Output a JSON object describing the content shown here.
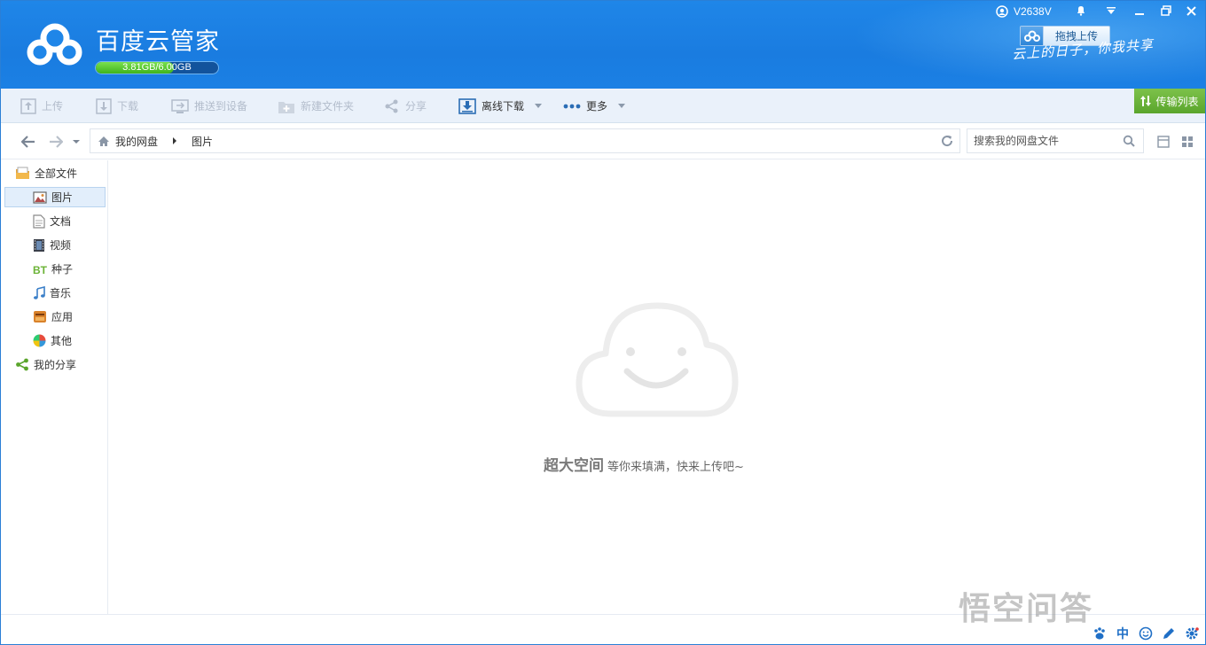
{
  "app": {
    "title": "百度云管家",
    "quota_text": "3.81GB/6.00GB",
    "quota_used_fraction": 0.635,
    "username": "V2638V",
    "drag_upload_label": "拖拽上传",
    "slogan": "云上的日子，你我共享"
  },
  "toolbar": {
    "upload": "上传",
    "download": "下载",
    "push": "推送到设备",
    "new_folder": "新建文件夹",
    "share": "分享",
    "offline": "离线下载",
    "more": "更多",
    "transfer_list": "传输列表"
  },
  "breadcrumb": {
    "root": "我的网盘",
    "current": "图片"
  },
  "search": {
    "placeholder": "搜索我的网盘文件"
  },
  "sidebar": {
    "items": [
      {
        "label": "全部文件",
        "icon": "folder-all-icon"
      },
      {
        "label": "图片",
        "icon": "picture-icon"
      },
      {
        "label": "文档",
        "icon": "document-icon"
      },
      {
        "label": "视频",
        "icon": "video-icon"
      },
      {
        "label": "种子",
        "icon": "bt-icon"
      },
      {
        "label": "音乐",
        "icon": "music-icon"
      },
      {
        "label": "应用",
        "icon": "app-icon"
      },
      {
        "label": "其他",
        "icon": "other-icon"
      },
      {
        "label": "我的分享",
        "icon": "share-icon"
      }
    ]
  },
  "empty": {
    "title": "超大空间",
    "subtitle": "等你来填满，快来上传吧~"
  },
  "watermark": "悟空问答",
  "tray": {
    "ime": "中"
  },
  "colors": {
    "header_blue": "#1f86e8",
    "transfer_green": "#5aa52c",
    "quota_green": "#3fb41d"
  }
}
